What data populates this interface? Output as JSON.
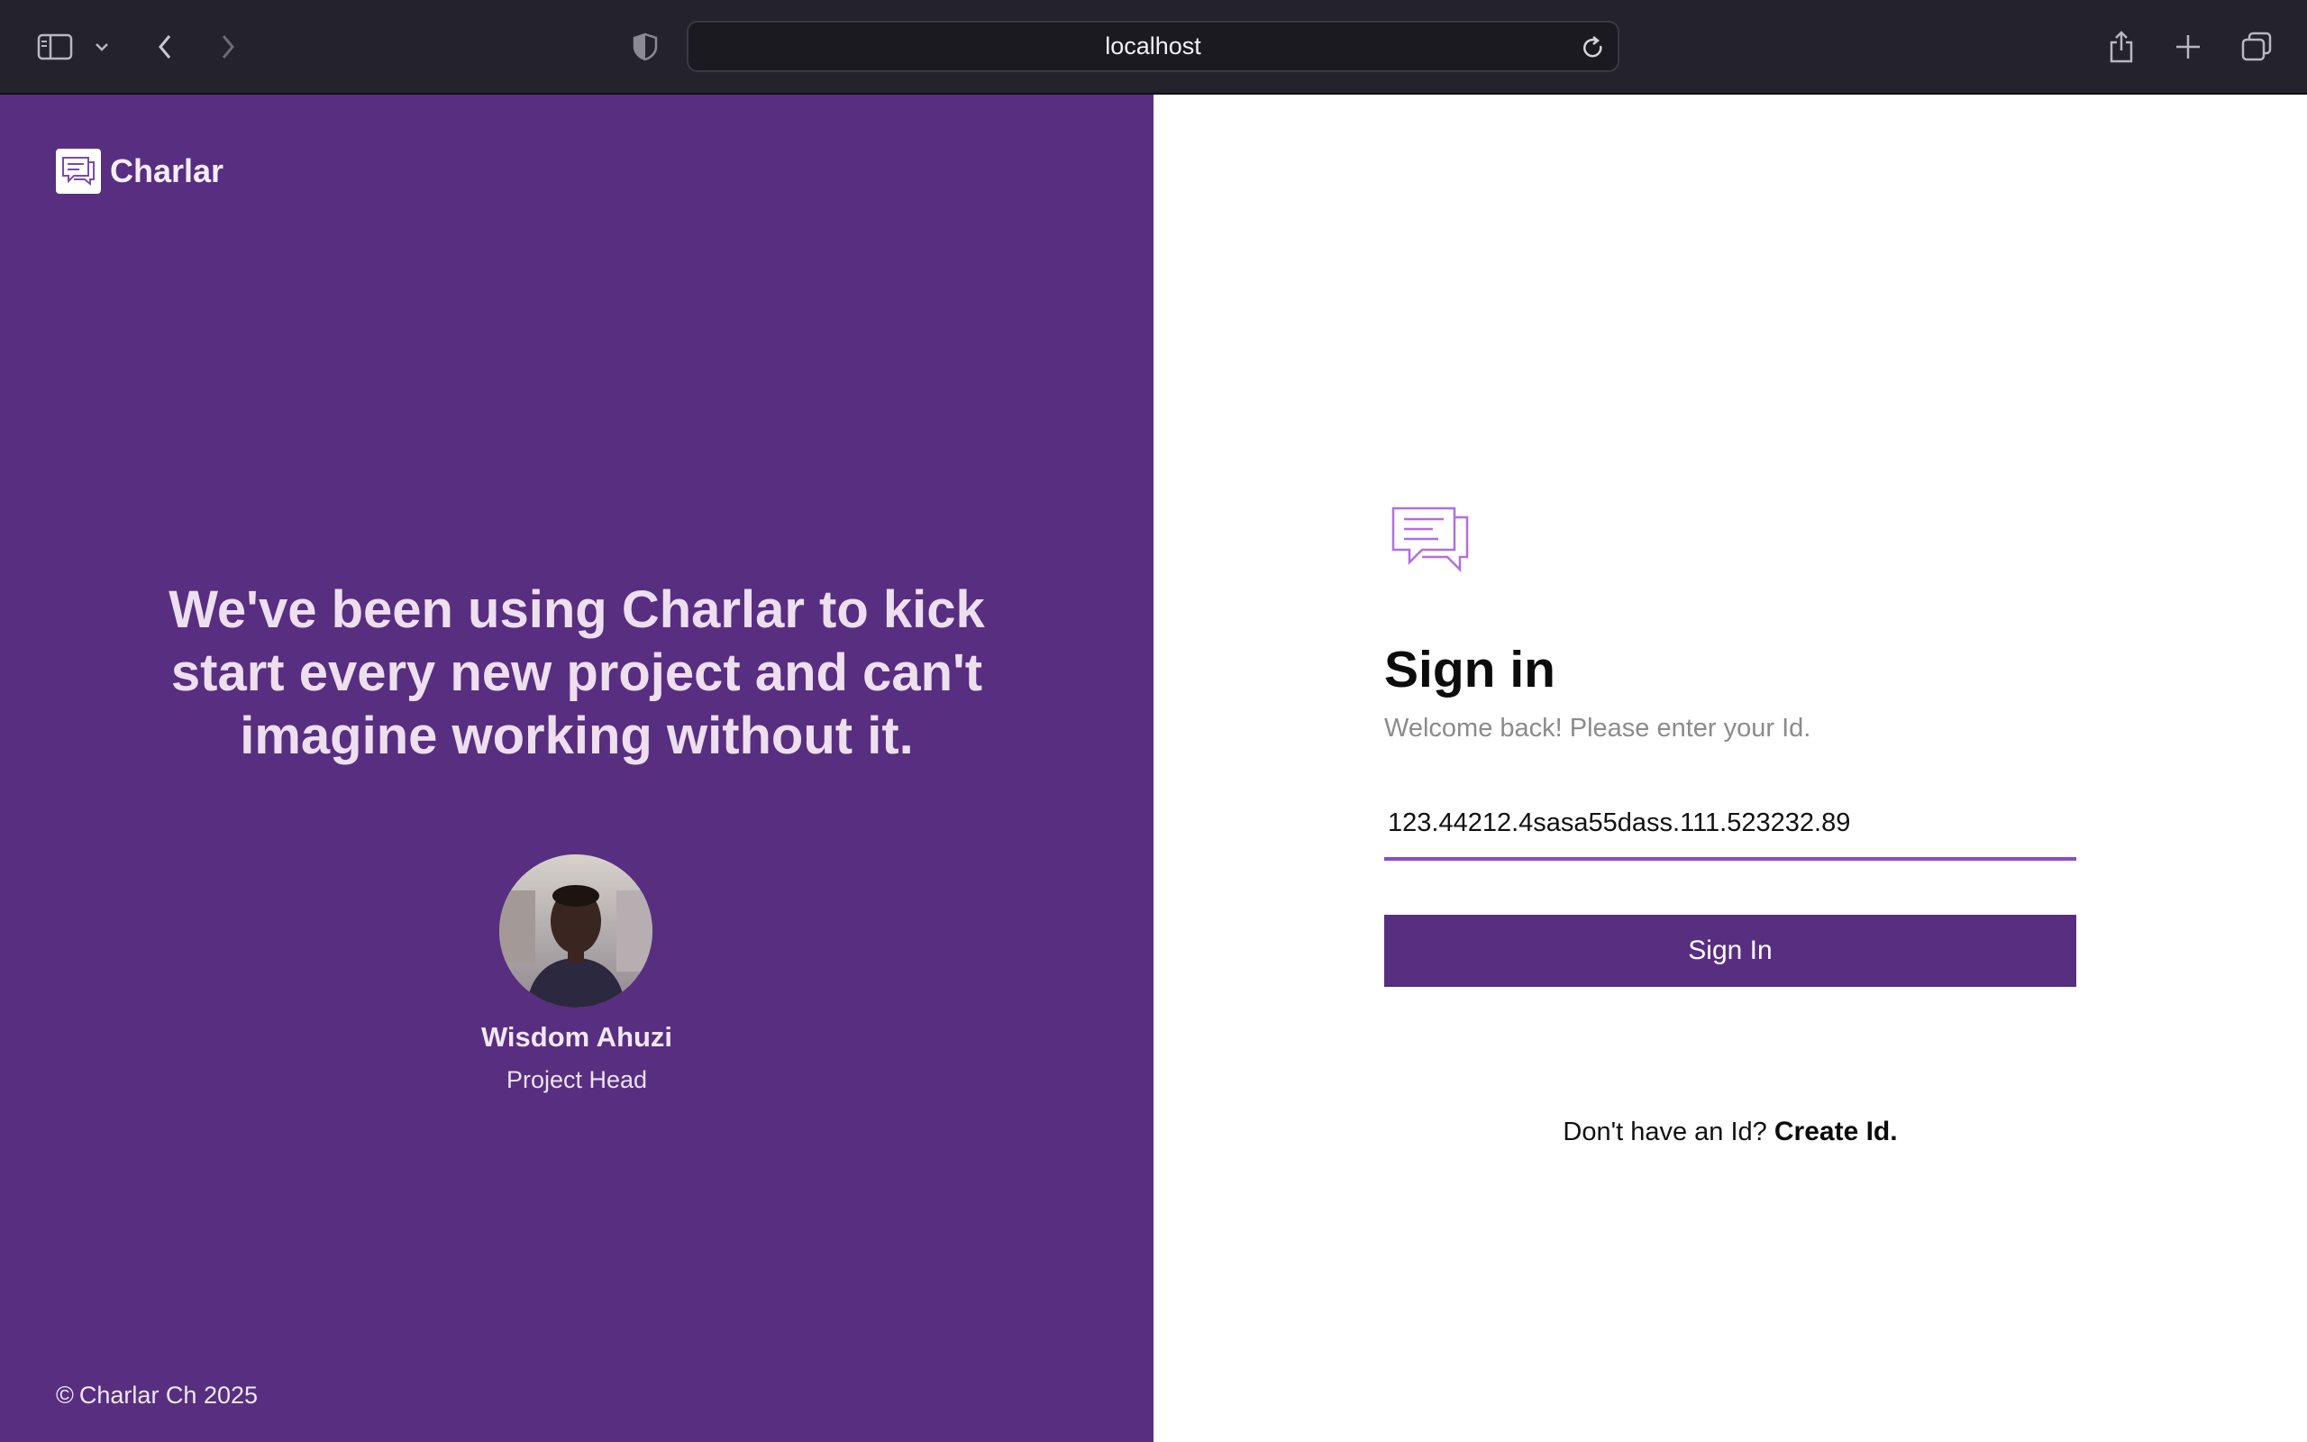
{
  "browser": {
    "url": "localhost",
    "icons": {
      "sidebar": "sidebar-icon",
      "sidebar_menu": "chevron-down-icon",
      "back": "chevron-left-icon",
      "forward": "chevron-right-icon",
      "privacy": "shield-icon",
      "reload": "reload-icon",
      "share": "share-icon",
      "new_tab": "plus-icon",
      "tab_overview": "tabs-icon"
    }
  },
  "brand": {
    "name": "Charlar",
    "logo_icon": "chat-bubbles-icon"
  },
  "testimonial": {
    "quote": "We've been using Charlar to kick start every new project and can't imagine working without it.",
    "name": "Wisdom Ahuzi",
    "role": "Project Head"
  },
  "footer": {
    "copyright_symbol": "©",
    "text": "Charlar Ch 2025"
  },
  "signin": {
    "logo_icon": "chat-bubbles-icon",
    "title": "Sign in",
    "subtitle": "Welcome back! Please enter your Id.",
    "id_value": "123.44212.4sasa55dass.111.523232.89",
    "button_label": "Sign In",
    "no_account_text": "Don't have an Id?",
    "create_link": "Create Id."
  },
  "colors": {
    "primary_purple": "#582e80",
    "input_underline": "#8a4ad0",
    "logo_stroke": "#b46ee0",
    "chrome_bg": "#24222a"
  }
}
